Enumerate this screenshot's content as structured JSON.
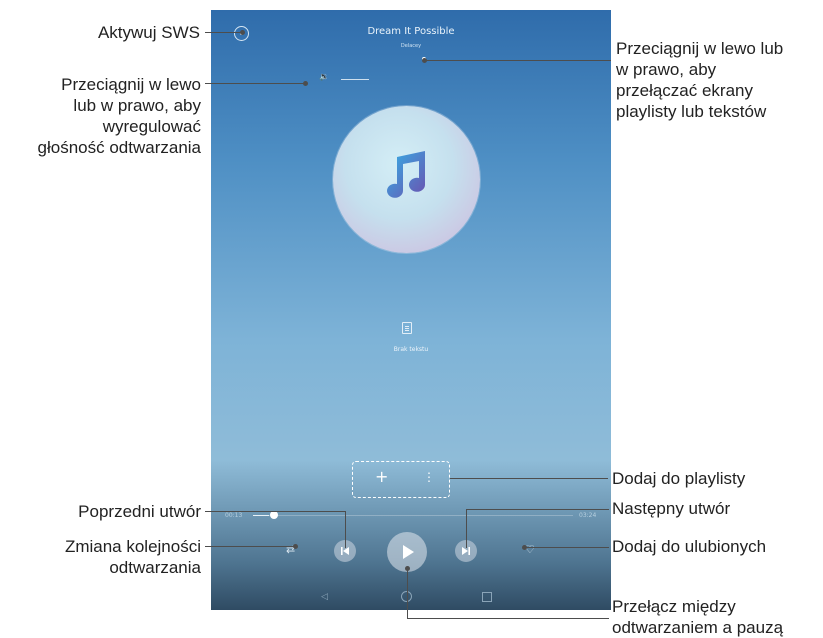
{
  "screen": {
    "song_title": "Dream It Possible",
    "song_artist": "Delacey",
    "no_lyrics_label": "Brak tekstu",
    "time_current": "00:13",
    "time_total": "03:24",
    "progress_fraction": 0.05,
    "add_symbol": "+",
    "more_symbol": "⋮",
    "prev_symbol": "⏮",
    "play_symbol": "▶",
    "next_symbol": "⏭",
    "shuffle_symbol": "⇄",
    "heart_symbol": "♡",
    "volume_symbol": "🔉",
    "back_symbol": "◁"
  },
  "annotations": {
    "sws": "Aktywuj SWS",
    "volume_line1": "Przeciągnij w lewo",
    "volume_line2": "lub w prawo, aby",
    "volume_line3": "wyregulować",
    "volume_line4": "głośność odtwarzania",
    "swipe_line1": "Przeciągnij w lewo lub",
    "swipe_line2": "w prawo, aby",
    "swipe_line3": "przełączać ekrany",
    "swipe_line4": "playlisty lub tekstów",
    "add_playlist": "Dodaj do playlisty",
    "prev_track": "Poprzedni utwór",
    "next_track": "Następny utwór",
    "shuffle_line1": "Zmiana kolejności",
    "shuffle_line2": "odtwarzania",
    "favorite": "Dodaj do ulubionych",
    "playpause_line1": "Przełącz między",
    "playpause_line2": "odtwarzaniem a pauzą"
  },
  "colors": {
    "screen_top": "#2f6cab",
    "screen_mid": "#8fbcd8",
    "screen_bottom": "#2f4b63",
    "note_blue": "#3aa0e0",
    "note_purple": "#6b5fb5"
  }
}
